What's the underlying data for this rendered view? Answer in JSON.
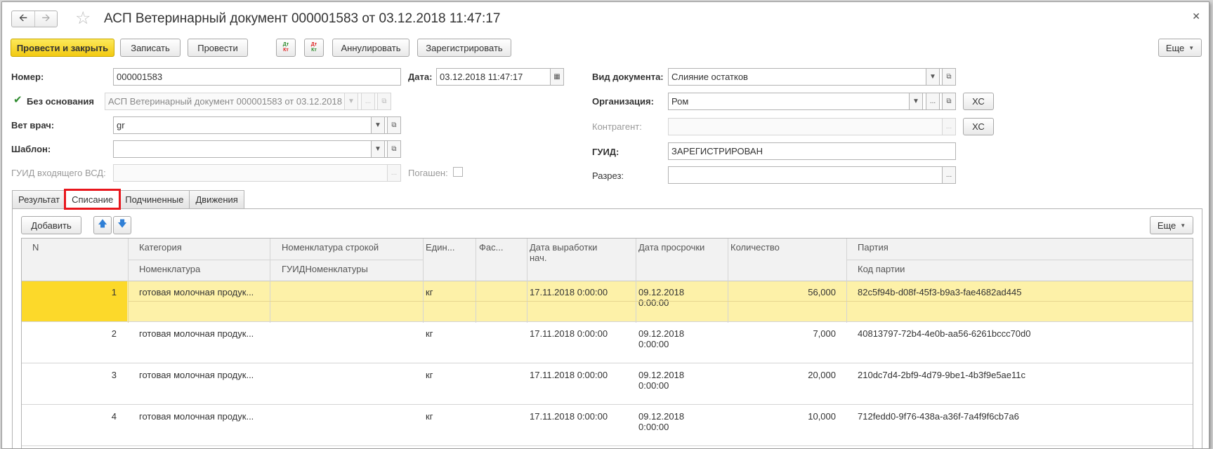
{
  "window": {
    "title": "АСП Ветеринарный документ 000001583 от 03.12.2018 11:47:17",
    "back_icon": "arrow-left-icon",
    "forward_icon": "arrow-right-icon",
    "favorite_icon": "star-icon",
    "close_icon": "close-icon"
  },
  "toolbar": {
    "post_and_close": "Провести и закрыть",
    "save": "Записать",
    "post": "Провести",
    "dtkt_top": "Дт",
    "dtkt_bottom": "Кт",
    "cancel": "Аннулировать",
    "register": "Зарегистрировать",
    "more": "Еще"
  },
  "form": {
    "number_label": "Номер:",
    "number_value": "000001583",
    "date_label": "Дата:",
    "date_value": "03.12.2018 11:47:17",
    "no_basis_label": "Без основания",
    "no_basis_checked": true,
    "basis_value": "АСП Ветеринарный документ 000001583 от 03.12.2018 11:47:17",
    "vet_label": "Вет врач:",
    "vet_value": "gr",
    "template_label": "Шаблон:",
    "template_value": "",
    "incoming_guid_label": "ГУИД входящего ВСД:",
    "incoming_guid_value": "",
    "repaid_label": "Погашен:",
    "doc_type_label": "Вид документа:",
    "doc_type_value": "Слияние остатков",
    "org_label": "Организация:",
    "org_value": "Ром",
    "org_xc": "ХС",
    "counterparty_label": "Контрагент:",
    "counterparty_value": "",
    "counterparty_xc": "ХС",
    "guid_label": "ГУИД:",
    "guid_value": "ЗАРЕГИСТРИРОВАН",
    "section_label": "Разрез:",
    "section_value": "",
    "dots": "..."
  },
  "tabs": [
    {
      "label": "Результат"
    },
    {
      "label": "Списание"
    },
    {
      "label": "Подчиненные"
    },
    {
      "label": "Движения"
    }
  ],
  "grid_toolbar": {
    "add": "Добавить",
    "move_up_icon": "arrow-up-icon",
    "move_down_icon": "arrow-down-icon",
    "more": "Еще"
  },
  "grid": {
    "headers": {
      "n": "N",
      "category": "Категория",
      "nomenclature": "Номенклатура",
      "nom_string": "Номенклатура строкой",
      "nom_guid": "ГУИДНоменклатуры",
      "unit": "Един...",
      "pack": "Фас...",
      "prod_date_1": "Дата выработки",
      "prod_date_2": "нач.",
      "expiry": "Дата просрочки",
      "qty": "Количество",
      "batch": "Партия",
      "batch_code": "Код партии"
    },
    "rows": [
      {
        "n": "1",
        "category": "готовая молочная продук...",
        "unit": "кг",
        "prod_date": "17.11.2018 0:00:00",
        "expiry_1": "09.12.2018",
        "expiry_2": "0:00:00",
        "qty": "56,000",
        "batch": "82c5f94b-d08f-45f3-b9a3-fae4682ad445"
      },
      {
        "n": "2",
        "category": "готовая молочная продук...",
        "unit": "кг",
        "prod_date": "17.11.2018 0:00:00",
        "expiry_1": "09.12.2018",
        "expiry_2": "0:00:00",
        "qty": "7,000",
        "batch": "40813797-72b4-4e0b-aa56-6261bccc70d0"
      },
      {
        "n": "3",
        "category": "готовая молочная продук...",
        "unit": "кг",
        "prod_date": "17.11.2018 0:00:00",
        "expiry_1": "09.12.2018",
        "expiry_2": "0:00:00",
        "qty": "20,000",
        "batch": "210dc7d4-2bf9-4d79-9be1-4b3f9e5ae11c"
      },
      {
        "n": "4",
        "category": "готовая молочная продук...",
        "unit": "кг",
        "prod_date": "17.11.2018 0:00:00",
        "expiry_1": "09.12.2018",
        "expiry_2": "0:00:00",
        "qty": "10,000",
        "batch": "712fedd0-9f76-438a-a36f-7a4f9f6cb7a6"
      }
    ]
  }
}
